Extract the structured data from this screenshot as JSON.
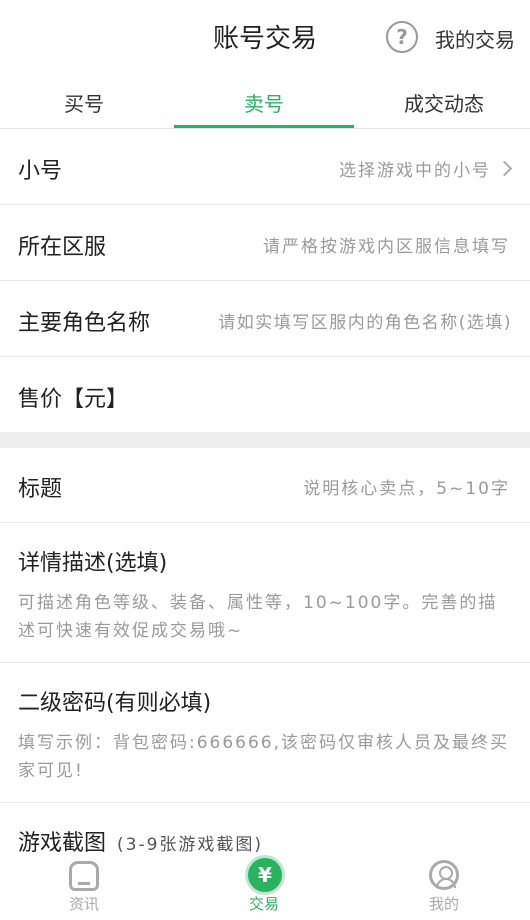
{
  "header": {
    "title": "账号交易",
    "help_icon": "?",
    "my_trade": "我的交易"
  },
  "tabs": [
    {
      "label": "买号",
      "active": false
    },
    {
      "label": "卖号",
      "active": true
    },
    {
      "label": "成交动态",
      "active": false
    }
  ],
  "form": {
    "sub_account": {
      "label": "小号",
      "hint": "选择游戏中的小号"
    },
    "server": {
      "label": "所在区服",
      "hint": "请严格按游戏内区服信息填写"
    },
    "role_name": {
      "label": "主要角色名称",
      "hint": "请如实填写区服内的角色名称(选填)"
    },
    "price": {
      "label": "售价【元】"
    },
    "title": {
      "label": "标题",
      "hint": "说明核心卖点，5~10字"
    },
    "description": {
      "label": "详情描述(选填)",
      "hint": "可描述角色等级、装备、属性等，10~100字。完善的描述可快速有效促成交易哦~"
    },
    "password": {
      "label": "二级密码(有则必填)",
      "hint": "填写示例：背包密码:666666,该密码仅审核人员及最终买家可见!"
    },
    "screenshots": {
      "label": "游戏截图",
      "hint": "(3-9张游戏截图)"
    }
  },
  "tabbar": [
    {
      "label": "资讯",
      "icon": "home-icon",
      "active": false
    },
    {
      "label": "交易",
      "icon": "yen-icon",
      "active": true,
      "icon_text": "¥"
    },
    {
      "label": "我的",
      "icon": "user-icon",
      "active": false
    }
  ],
  "colors": {
    "accent": "#2ab261",
    "hint": "#9a9a9a",
    "divider": "#e8e8e8"
  }
}
